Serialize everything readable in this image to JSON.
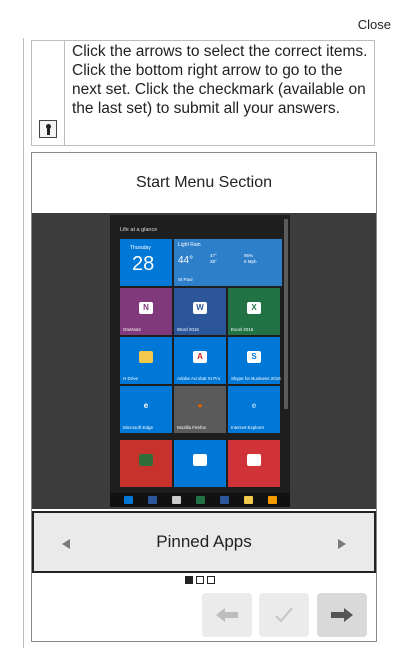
{
  "header": {
    "close_label": "Close"
  },
  "instructions": {
    "text": "Click the arrows to select the correct items. Click the bottom right arrow to go to the next set. Click the checkmark (available on the last set) to submit all your answers."
  },
  "card": {
    "title": "Start Menu Section"
  },
  "start_menu": {
    "heading": "Life at a glance",
    "calendar": {
      "day": "Thursday",
      "date": "28"
    },
    "weather": {
      "title": "Light Rain",
      "temp": "44°",
      "hi_lo": "47°\n38°",
      "humidity": "95%",
      "wind": "6 Mph",
      "city": "St Paul"
    },
    "tiles": [
      {
        "label": "OneNote",
        "color": "#80397b",
        "symbol": "N",
        "symbol_bg": "#ffffff",
        "symbol_color": "#80397b"
      },
      {
        "label": "Word 2016",
        "color": "#2b579a",
        "symbol": "W",
        "symbol_bg": "#ffffff",
        "symbol_color": "#2b579a"
      },
      {
        "label": "Excel 2016",
        "color": "#217346",
        "symbol": "X",
        "symbol_bg": "#ffffff",
        "symbol_color": "#217346"
      },
      {
        "label": "H Drive",
        "color": "#0078d7",
        "symbol": "▬",
        "symbol_bg": "#f2c94c",
        "symbol_color": "#f2c94c"
      },
      {
        "label": "Adobe Acrobat XI Pro",
        "color": "#0078d7",
        "symbol": "A",
        "symbol_bg": "#ffffff",
        "symbol_color": "#d11f1f"
      },
      {
        "label": "Skype for Business 2016",
        "color": "#0078d7",
        "symbol": "S",
        "symbol_bg": "#ffffff",
        "symbol_color": "#0078d7"
      },
      {
        "label": "Microsoft Edge",
        "color": "#0078d7",
        "symbol": "e",
        "symbol_bg": "#0078d7",
        "symbol_color": "#ffffff"
      },
      {
        "label": "Mozilla Firefox",
        "color": "#5a5a5a",
        "symbol": "●",
        "symbol_bg": "#5a5a5a",
        "symbol_color": "#e66000"
      },
      {
        "label": "Internet Explorer",
        "color": "#0078d7",
        "symbol": "e",
        "symbol_bg": "#0078d7",
        "symbol_color": "#a7d8ff"
      },
      {
        "label": "",
        "color": "#c7332c",
        "symbol": "",
        "symbol_bg": "#2f6d3a",
        "symbol_color": "#ffffff"
      },
      {
        "label": "",
        "color": "#0078d7",
        "symbol": "",
        "symbol_bg": "#ffffff",
        "symbol_color": "#0078d7"
      },
      {
        "label": "",
        "color": "#d13438",
        "symbol": "",
        "symbol_bg": "#ffffff",
        "symbol_color": "#d13438"
      }
    ],
    "taskbar_colors": [
      "#0078d7",
      "#2b579a",
      "#cccccc",
      "#217346",
      "#2b579a",
      "#f2c94c",
      "#f59b00"
    ]
  },
  "selector": {
    "current": "Pinned Apps"
  },
  "pagination": {
    "current": 1,
    "total": 3
  }
}
